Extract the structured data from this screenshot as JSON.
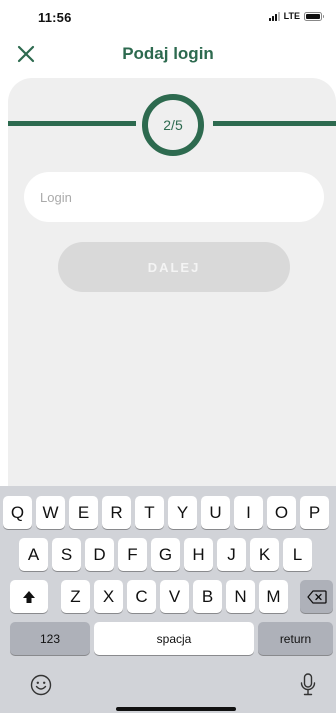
{
  "status_bar": {
    "time": "11:56",
    "network": "LTE"
  },
  "header": {
    "title": "Podaj login",
    "close_icon": "close-icon"
  },
  "progress": {
    "step_label": "2/5"
  },
  "form": {
    "login_placeholder": "Login",
    "login_value": "",
    "next_label": "DALEJ"
  },
  "keyboard": {
    "row1": [
      "Q",
      "W",
      "E",
      "R",
      "T",
      "Y",
      "U",
      "I",
      "O",
      "P"
    ],
    "row2": [
      "A",
      "S",
      "D",
      "F",
      "G",
      "H",
      "J",
      "K",
      "L"
    ],
    "row3": [
      "Z",
      "X",
      "C",
      "V",
      "B",
      "N",
      "M"
    ],
    "numbers_label": "123",
    "space_label": "spacja",
    "return_label": "return",
    "icons": [
      "shift-icon",
      "backspace-icon",
      "emoji-icon",
      "microphone-icon"
    ]
  },
  "colors": {
    "brand_green": "#2d6a4f",
    "card_background": "#efefef",
    "button_disabled": "#d9d9d9",
    "keyboard_background": "#d1d3d8"
  }
}
